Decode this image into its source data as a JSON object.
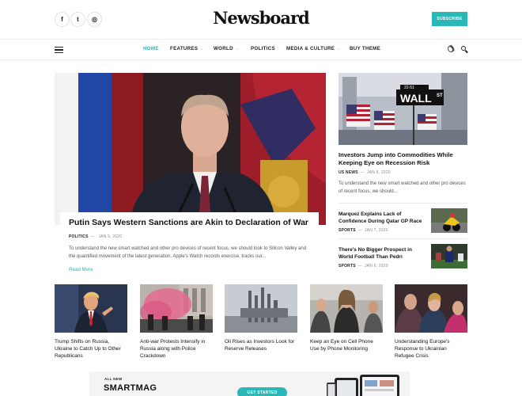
{
  "header": {
    "logo": "Newsboard",
    "subscribe_label": "SUBSCRIBE",
    "social": [
      {
        "icon": "facebook-icon",
        "glyph": "f"
      },
      {
        "icon": "twitter-icon",
        "glyph": "t"
      },
      {
        "icon": "instagram-icon",
        "glyph": "◎"
      }
    ]
  },
  "nav": {
    "items": [
      {
        "label": "HOME",
        "active": true,
        "dropdown": false
      },
      {
        "label": "FEATURES",
        "active": false,
        "dropdown": true
      },
      {
        "label": "WORLD",
        "active": false,
        "dropdown": true
      },
      {
        "label": "POLITICS",
        "active": false,
        "dropdown": false
      },
      {
        "label": "MEDIA & CULTURE",
        "active": false,
        "dropdown": true
      },
      {
        "label": "BUY THEME",
        "active": false,
        "dropdown": false
      }
    ]
  },
  "hero": {
    "title": "Putin Says Western Sanctions are Akin to Declaration of War",
    "category": "POLITICS",
    "date": "JAN 9, 2020",
    "excerpt": "To understand the new smart watched and other pro devices of recent focus, we should look to Silicon Valley and the quantified movement of the latest generation. Apple's Watch records exercise, tracks our...",
    "read_more": "Read More"
  },
  "side_feature": {
    "title": "Investors Jump into Commodities While Keeping Eye on Recession Risk",
    "category": "US NEWS",
    "date": "JAN 9, 2020",
    "excerpt": "To understand the new smart watched and other pro devices of recent focus, we should...",
    "sign_text": "WALL",
    "sign_suffix": "ST",
    "sign_number": "22-51"
  },
  "side_list": [
    {
      "title": "Marquez Explains Lack of Confidence During Qatar GP Race",
      "category": "SPORTS",
      "date": "JAN 7, 2020"
    },
    {
      "title": "There's No Bigger Prospect in World Football Than Pedri",
      "category": "SPORTS",
      "date": "JAN 6, 2020"
    }
  ],
  "bottom_cards": [
    {
      "title": "Trump Shifts on Russia, Ukraine to Catch Up to Other Republicans"
    },
    {
      "title": "Anti-war Protests Intensify in Russia along with Police Crackdown"
    },
    {
      "title": "Oil Rises as Investors Look for Reserve Releases"
    },
    {
      "title": "Keep an Eye on Cell Phone Use by Phone Monitoring"
    },
    {
      "title": "Understanding Europe's Response to Ukrainian Refugee Crisis"
    }
  ],
  "ad": {
    "small": "ALL NEW",
    "big": "SMARTMAG",
    "button": "GET STARTED"
  },
  "colors": {
    "accent": "#2ab7b7"
  }
}
